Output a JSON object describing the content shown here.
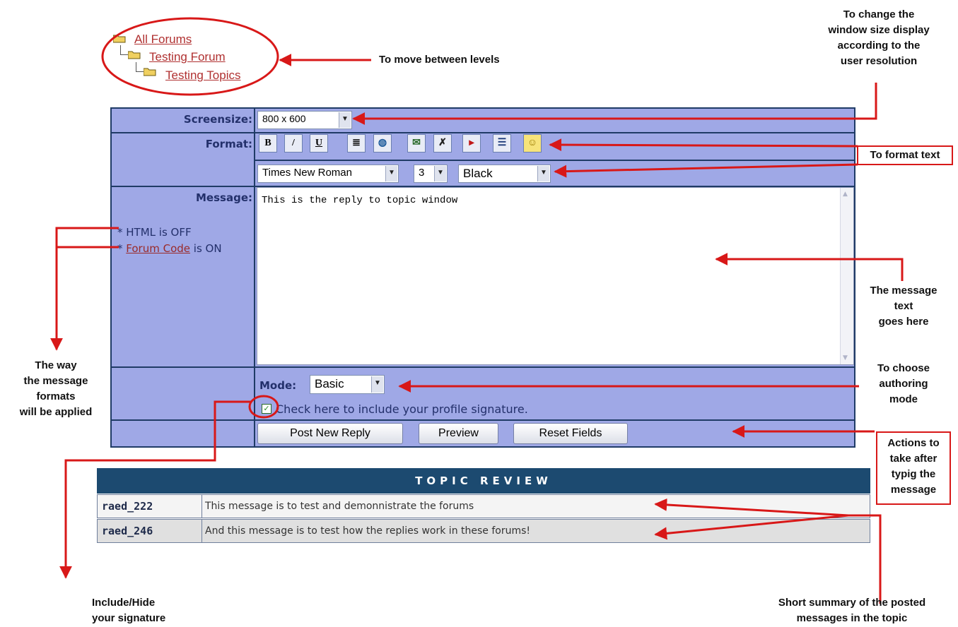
{
  "breadcrumb": {
    "level1": "All Forums",
    "level2": "Testing Forum",
    "level3": "Testing Topics"
  },
  "form": {
    "screensize_label": "Screensize:",
    "screensize_value": "800 x 600",
    "format_label": "Format:",
    "toolbar": [
      {
        "icon": "bold-icon",
        "glyph": "B"
      },
      {
        "icon": "italic-icon",
        "glyph": "/"
      },
      {
        "icon": "underline-icon",
        "glyph": "U"
      },
      {
        "icon": "center-align-icon",
        "glyph": "≣"
      },
      {
        "icon": "hyperlink-icon",
        "glyph": "◍"
      },
      {
        "icon": "email-icon",
        "glyph": "✉"
      },
      {
        "icon": "quote-icon",
        "glyph": "✗"
      },
      {
        "icon": "image-icon",
        "glyph": "▸"
      },
      {
        "icon": "list-icon",
        "glyph": "☰"
      },
      {
        "icon": "smiley-icon",
        "glyph": "☺"
      }
    ],
    "font_value": "Times New Roman",
    "size_value": "3",
    "color_value": "Black",
    "message_label": "Message:",
    "html_status": "HTML is OFF",
    "forum_code_link": "Forum Code",
    "forum_code_status": " is ON",
    "message_text": "This is the reply to topic window",
    "mode_label": "Mode:",
    "mode_value": "Basic",
    "signature_label": "Check here to include your profile signature.",
    "post_button": "Post New Reply",
    "preview_button": "Preview",
    "reset_button": "Reset Fields"
  },
  "topic_review": {
    "header": "TOPIC REVIEW",
    "rows": [
      {
        "user": "raed_222",
        "message": "This message is to test and demonnistrate the forums"
      },
      {
        "user": "raed_246",
        "message": "And this message is to test how the replies work in these forums!"
      }
    ]
  },
  "annotations": {
    "move_levels": "To move between levels",
    "window_size": [
      "To change the",
      "window size display",
      "according to the",
      "user resolution"
    ],
    "format_text": "To format text",
    "message_text": [
      "The message",
      "text",
      "goes here"
    ],
    "authoring": [
      "To choose",
      "authoring",
      "mode"
    ],
    "actions": [
      "Actions to",
      "take after",
      "typig the",
      "message"
    ],
    "message_formats": [
      "The way",
      "the message",
      "formats",
      "will be applied"
    ],
    "signature": [
      "Include/Hide",
      "your signature"
    ],
    "summary": [
      "Short summary of the posted",
      "messages in the topic"
    ]
  },
  "colors": {
    "form_bg": "#9fa8e6",
    "form_border": "#1f3b66",
    "review_header": "#1c4a70",
    "annotation_red": "#d81818"
  }
}
